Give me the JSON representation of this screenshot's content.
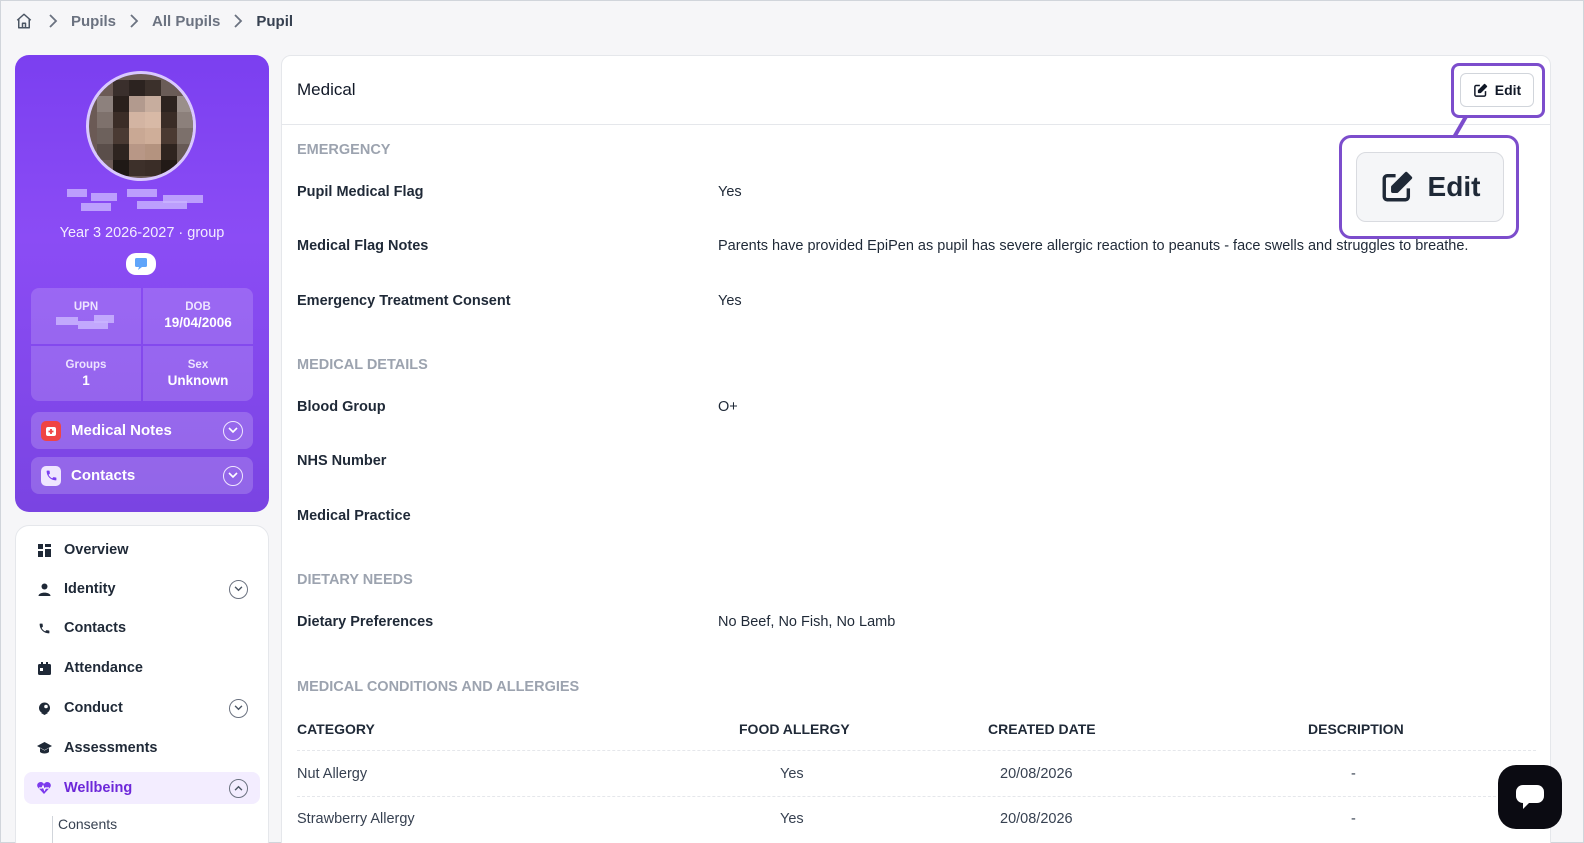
{
  "breadcrumb": {
    "items": [
      "Pupils",
      "All Pupils"
    ],
    "current": "Pupil"
  },
  "profile": {
    "year_group": "Year 3 2026-2027 · group",
    "stats": {
      "upn_label": "UPN",
      "dob_label": "DOB",
      "dob_value": "19/04/2006",
      "groups_label": "Groups",
      "groups_value": "1",
      "sex_label": "Sex",
      "sex_value": "Unknown"
    },
    "medical_notes_label": "Medical Notes",
    "contacts_label": "Contacts"
  },
  "nav": {
    "overview": "Overview",
    "identity": "Identity",
    "contacts": "Contacts",
    "attendance": "Attendance",
    "conduct": "Conduct",
    "assessments": "Assessments",
    "wellbeing": "Wellbeing",
    "consents": "Consents"
  },
  "main": {
    "title": "Medical",
    "edit_label": "Edit",
    "zoom_edit_label": "Edit",
    "emergency": {
      "heading": "EMERGENCY",
      "pupil_medical_flag_label": "Pupil Medical Flag",
      "pupil_medical_flag_value": "Yes",
      "medical_flag_notes_label": "Medical Flag Notes",
      "medical_flag_notes_value": "Parents have provided EpiPen as pupil has severe allergic reaction to peanuts - face swells and struggles to breathe.",
      "emergency_treatment_consent_label": "Emergency Treatment Consent",
      "emergency_treatment_consent_value": "Yes"
    },
    "medical_details": {
      "heading": "MEDICAL DETAILS",
      "blood_group_label": "Blood Group",
      "blood_group_value": "O+",
      "nhs_number_label": "NHS Number",
      "medical_practice_label": "Medical Practice"
    },
    "dietary": {
      "heading": "DIETARY NEEDS",
      "preferences_label": "Dietary Preferences",
      "preferences_value": "No Beef, No Fish, No Lamb"
    },
    "conditions": {
      "heading": "MEDICAL CONDITIONS AND ALLERGIES",
      "columns": [
        "CATEGORY",
        "FOOD ALLERGY",
        "CREATED DATE",
        "DESCRIPTION"
      ],
      "rows": [
        [
          "Nut Allergy",
          "Yes",
          "20/08/2026",
          "-"
        ],
        [
          "Strawberry Allergy",
          "Yes",
          "20/08/2026",
          "-"
        ]
      ]
    }
  },
  "colors": {
    "brand": "#7b3ff0",
    "highlight": "#7c4dcc"
  }
}
